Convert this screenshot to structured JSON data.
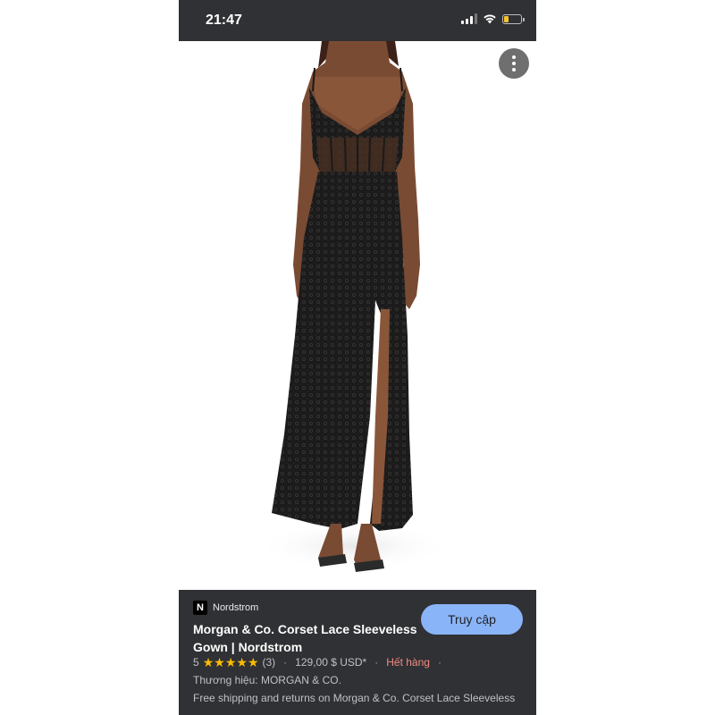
{
  "status_bar": {
    "time": "21:47",
    "battery_level": 0.25,
    "signal_bars": 3,
    "icons": [
      "signal-icon",
      "wifi-icon",
      "battery-icon"
    ]
  },
  "image_viewer": {
    "image_icon": "product-photo-dress",
    "menu_icon": "more-vertical-icon"
  },
  "result": {
    "source_logo": "N",
    "source_name": "Nordstrom",
    "title": "Morgan & Co. Corset Lace Sleeveless Gown | Nordstrom",
    "visit_button": "Truy cập",
    "rating": "5",
    "rating_value": 5,
    "review_count": "(3)",
    "price": "129,00 $ USD*",
    "stock_status": "Hết hàng",
    "brand": "Thương hiệu: MORGAN & CO.",
    "shipping": "Free shipping and returns on Morgan & Co. Corset Lace Sleeveless"
  },
  "colors": {
    "panel_bg": "#303134",
    "button_bg": "#8ab4f8",
    "star": "#fbbc04",
    "out_of_stock": "#f28b82"
  }
}
